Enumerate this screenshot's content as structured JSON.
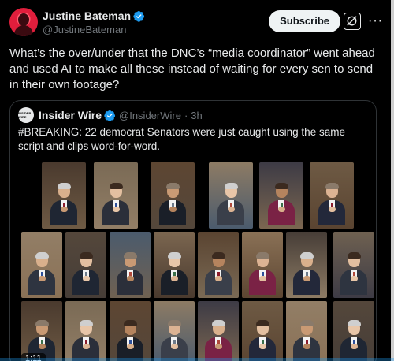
{
  "author": {
    "display_name": "Justine Bateman",
    "handle": "@JustineBateman",
    "avatar": "avatar-silhouette",
    "verified_icon": "verified-badge-icon"
  },
  "actions": {
    "subscribe_label": "Subscribe",
    "grok_icon": "grok-icon",
    "more_icon": "more-dots-icon",
    "more_glyph": "···"
  },
  "post": {
    "text": "What’s the over/under that the DNC’s “media coordinator” went ahead and used AI to make all these instead of waiting for every sen to send in their own footage?"
  },
  "quote": {
    "avatar_text": "INSIDER WIRE",
    "display_name": "Insider Wire",
    "handle": "@InsiderWire",
    "separator": "·",
    "time": "3h",
    "text": "#BREAKING: 22 democrat Senators were just caught using the same script and clips word-for-word."
  },
  "media": {
    "duration": "1:11",
    "accent": "#1d9bf0"
  }
}
